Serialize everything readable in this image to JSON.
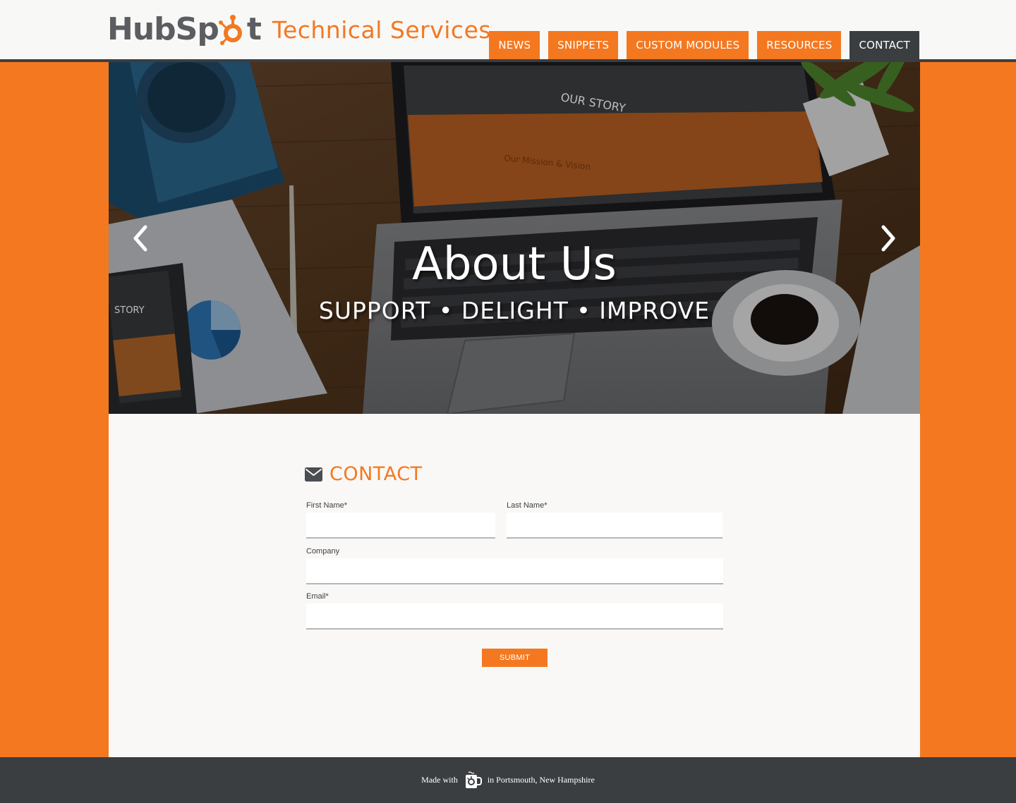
{
  "header": {
    "logo_text_before": "HubSp",
    "logo_text_after": "t",
    "tagline": "Technical Services",
    "nav": [
      {
        "label": "NEWS",
        "active": false
      },
      {
        "label": "SNIPPETS",
        "active": false
      },
      {
        "label": "CUSTOM MODULES",
        "active": false
      },
      {
        "label": "RESOURCES",
        "active": false
      },
      {
        "label": "CONTACT",
        "active": true
      }
    ]
  },
  "hero": {
    "title": "About Us",
    "subtitle": "SUPPORT  •  DELIGHT  •  IMPROVE",
    "screen_text": "OUR STORY",
    "screen_caption": "Our Mission & Vision",
    "phone_text": "STORY"
  },
  "contact": {
    "heading": "CONTACT",
    "first_name_label": "First Name*",
    "last_name_label": "Last Name*",
    "company_label": "Company",
    "email_label": "Email*",
    "first_name_value": "",
    "last_name_value": "",
    "company_value": "",
    "email_value": "",
    "submit_label": "SUBMIT"
  },
  "footer": {
    "made_with": "Made with",
    "location": "in Portsmouth, New Hampshire"
  },
  "colors": {
    "brand_orange": "#f47820",
    "charcoal": "#3b3e41",
    "logo_gray": "#5b5d61"
  },
  "icons": [
    "hubspot-sprocket-icon",
    "chevron-left-icon",
    "chevron-right-icon",
    "envelope-icon",
    "hubspot-mug-icon"
  ]
}
